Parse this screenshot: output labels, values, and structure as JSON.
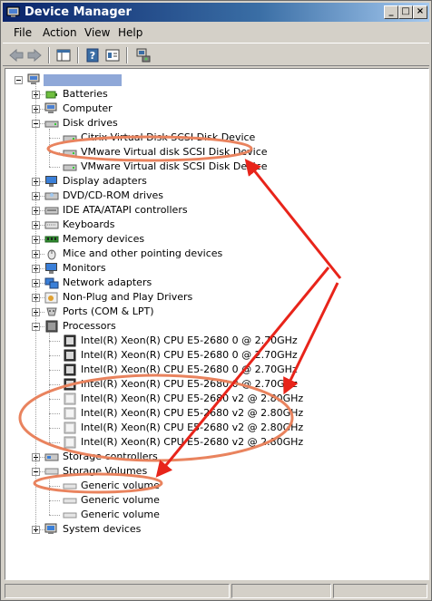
{
  "window": {
    "title": "Device Manager"
  },
  "menu": [
    "File",
    "Action",
    "View",
    "Help"
  ],
  "toolbar_icons": [
    "back-arrow-icon",
    "forward-arrow-icon",
    "show-hide-console-tree-icon",
    "help-icon",
    "properties-icon",
    "scan-hardware-icon"
  ],
  "colors": {
    "titlebar": "#0a246a",
    "annotation": "#e8241a",
    "highlight_ellipse": "#e9835e"
  },
  "tree": {
    "root_label": "",
    "categories": [
      {
        "label": "Batteries",
        "expanded": false,
        "icon": "battery-icon"
      },
      {
        "label": "Computer",
        "expanded": false,
        "icon": "computer-icon"
      },
      {
        "label": "Disk drives",
        "expanded": true,
        "icon": "disk-drive-icon",
        "children": [
          "Citrix Virtual Disk SCSI Disk Device",
          "VMware Virtual disk SCSI Disk Device",
          "VMware Virtual disk SCSI Disk Device"
        ]
      },
      {
        "label": "Display adapters",
        "expanded": false,
        "icon": "monitor-icon"
      },
      {
        "label": "DVD/CD-ROM drives",
        "expanded": false,
        "icon": "cdrom-icon"
      },
      {
        "label": "IDE ATA/ATAPI controllers",
        "expanded": false,
        "icon": "ide-controller-icon"
      },
      {
        "label": "Keyboards",
        "expanded": false,
        "icon": "keyboard-icon"
      },
      {
        "label": "Memory devices",
        "expanded": false,
        "icon": "memory-icon"
      },
      {
        "label": "Mice and other pointing devices",
        "expanded": false,
        "icon": "mouse-icon"
      },
      {
        "label": "Monitors",
        "expanded": false,
        "icon": "monitor-icon"
      },
      {
        "label": "Network adapters",
        "expanded": false,
        "icon": "network-adapter-icon"
      },
      {
        "label": "Non-Plug and Play Drivers",
        "expanded": false,
        "icon": "driver-icon"
      },
      {
        "label": "Ports (COM & LPT)",
        "expanded": false,
        "icon": "port-icon"
      },
      {
        "label": "Processors",
        "expanded": true,
        "icon": "processor-icon",
        "children": [
          "Intel(R) Xeon(R) CPU E5-2680 0 @ 2.70GHz",
          "Intel(R) Xeon(R) CPU E5-2680 0 @ 2.70GHz",
          "Intel(R) Xeon(R) CPU E5-2680 0 @ 2.70GHz",
          "Intel(R) Xeon(R) CPU E5-2680 0 @ 2.70GHz",
          "Intel(R) Xeon(R) CPU E5-2680 v2 @ 2.80GHz",
          "Intel(R) Xeon(R) CPU E5-2680 v2 @ 2.80GHz",
          "Intel(R) Xeon(R) CPU E5-2680 v2 @ 2.80GHz",
          "Intel(R) Xeon(R) CPU E5-2680 v2 @ 2.80GHz"
        ]
      },
      {
        "label": "Storage controllers",
        "expanded": false,
        "icon": "storage-controller-icon"
      },
      {
        "label": "Storage Volumes",
        "expanded": true,
        "icon": "storage-volume-icon",
        "children": [
          "Generic volume",
          "Generic volume",
          "Generic volume"
        ]
      },
      {
        "label": "System devices",
        "expanded": false,
        "icon": "system-devices-icon"
      }
    ]
  }
}
